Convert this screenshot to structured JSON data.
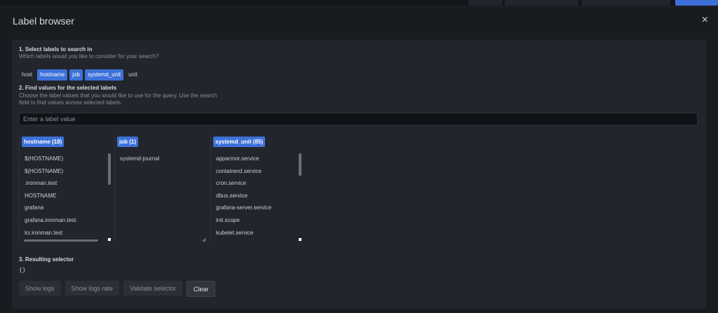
{
  "modal": {
    "title": "Label browser",
    "close_icon": "×"
  },
  "step1": {
    "heading": "1. Select labels to search in",
    "description": "Which labels would you like to consider for your search?",
    "labels": [
      {
        "name": "host",
        "selected": false
      },
      {
        "name": "hostname",
        "selected": true
      },
      {
        "name": "job",
        "selected": true
      },
      {
        "name": "systemd_unit",
        "selected": true
      },
      {
        "name": "unit",
        "selected": false
      }
    ]
  },
  "step2": {
    "heading": "2. Find values for the selected labels",
    "description_line1": "Choose the label values that you would like to use for the query. Use the search",
    "description_line2": "field to find values across selected labels.",
    "search_placeholder": "Enter a label value",
    "columns": [
      {
        "header": "hostname (18)",
        "values": [
          "$(HOSTNAME)",
          "$(HOSTNAME)",
          ".ironman.test",
          "HOSTNAME",
          "grafana",
          "grafana.ironman.test",
          "lcr.ironman.test"
        ]
      },
      {
        "header": "job (1)",
        "values": [
          "systemd-journal"
        ]
      },
      {
        "header": "systemd_unit (85)",
        "values": [
          "apparmor.service",
          "containerd.service",
          "cron.service",
          "dbus.service",
          "grafana-server.service",
          "init.scope",
          "kubelet.service"
        ]
      }
    ]
  },
  "step3": {
    "heading": "3. Resulting selector",
    "selector": "{}"
  },
  "buttons": {
    "show_logs": "Show logs",
    "show_logs_rate": "Show logs rate",
    "validate_selector": "Validate selector",
    "clear": "Clear"
  },
  "colors": {
    "accent": "#3d71d9",
    "panel": "#22252b",
    "modal": "#181b1f"
  }
}
